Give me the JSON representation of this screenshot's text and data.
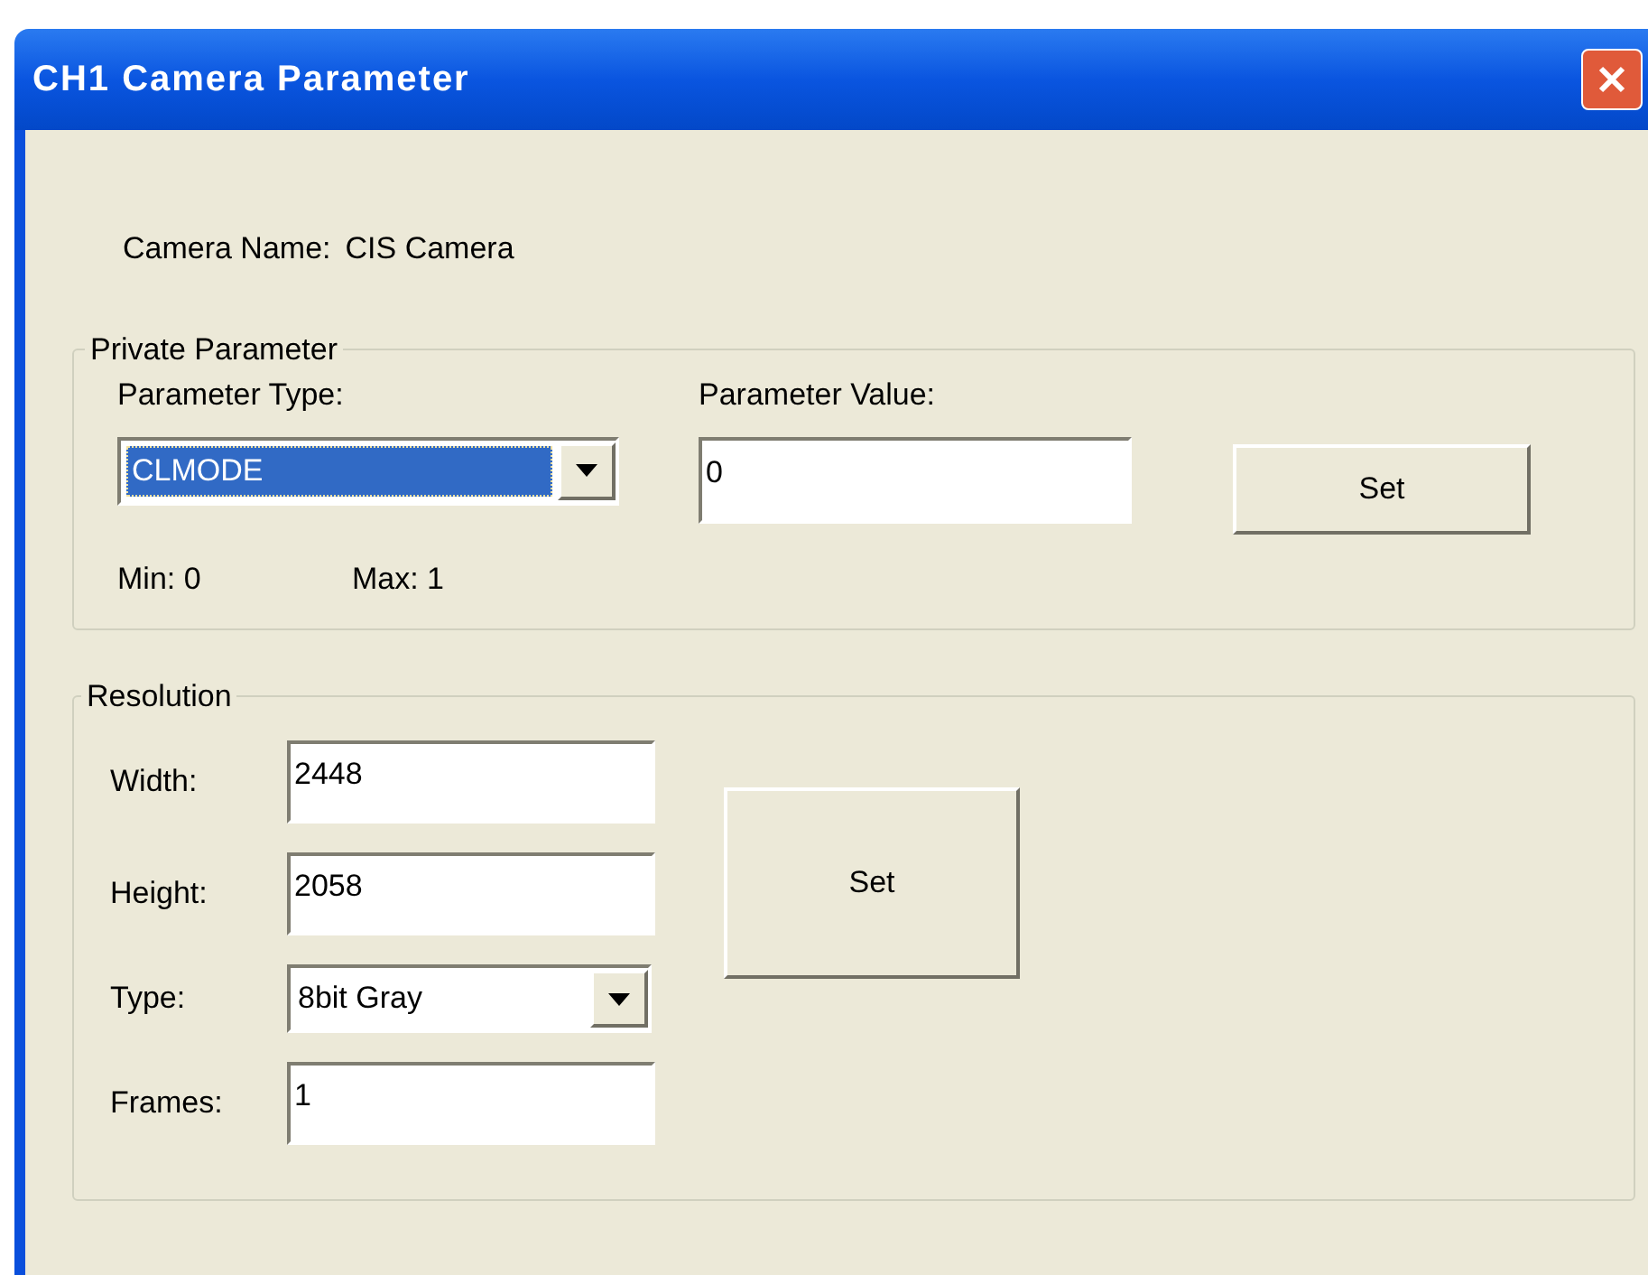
{
  "window": {
    "title": "CH1 Camera Parameter"
  },
  "camera_name": {
    "label": "Camera Name:",
    "value": "CIS Camera"
  },
  "private_parameter": {
    "title": "Private Parameter",
    "type_label": "Parameter Type:",
    "type_value": "CLMODE",
    "type_highlighted": true,
    "value_label": "Parameter Value:",
    "value": "0",
    "set_button": "Set",
    "min": "Min: 0",
    "max": "Max: 1"
  },
  "resolution": {
    "title": "Resolution",
    "fields": [
      {
        "kind": "text",
        "label": "Width:",
        "value": "2448"
      },
      {
        "kind": "text",
        "label": "Height:",
        "value": "2058"
      },
      {
        "kind": "dropdown",
        "label": "Type:",
        "value": "8bit Gray"
      },
      {
        "kind": "text",
        "label": "Frames:",
        "value": "1"
      }
    ],
    "set_button": "Set"
  }
}
